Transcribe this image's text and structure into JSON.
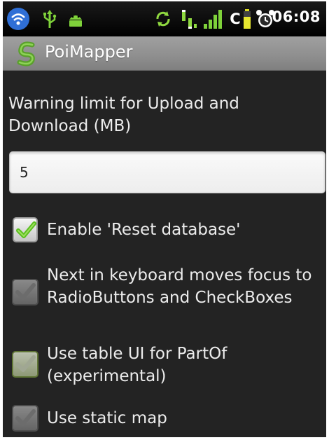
{
  "status_bar": {
    "time": "06:08",
    "carrier_letter": "C",
    "icons": [
      "wifi-icon",
      "usb-icon",
      "android-debug-icon",
      "sync-icon",
      "network-data-icon",
      "signal-icon",
      "battery-icon",
      "alarm-icon"
    ]
  },
  "app_bar": {
    "title": "PoiMapper",
    "logo_color": "#5aa02c"
  },
  "settings": {
    "warning_label": "Warning limit for Upload and Download (MB)",
    "warning_value": "5",
    "checkboxes": [
      {
        "label": "Enable 'Reset database'",
        "checked": true,
        "enabled": true
      },
      {
        "label": "Next in keyboard moves focus to RadioButtons and CheckBoxes",
        "checked": true,
        "enabled": false
      },
      {
        "label": "Use table UI for PartOf (experimental)",
        "checked": true,
        "enabled": false
      },
      {
        "label": "Use static map",
        "checked": true,
        "enabled": false
      }
    ]
  },
  "colors": {
    "background": "#232323",
    "title_bar": "#8e8e8e",
    "check_green": "#6cc42a",
    "text": "#ececec"
  }
}
